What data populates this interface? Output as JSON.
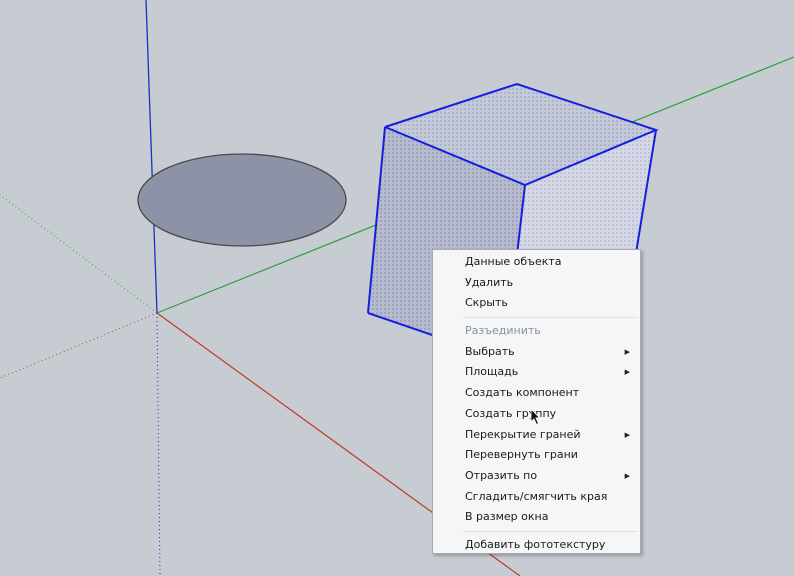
{
  "viewport": {
    "scene": "3d-modeling-viewport",
    "axis_colors": {
      "red": "#c0392b",
      "green": "#2e9e3a",
      "blue": "#1b2ecc"
    }
  },
  "context_menu": {
    "items": [
      {
        "label": "Данные объекта",
        "submenu": false,
        "disabled": false
      },
      {
        "label": "Удалить",
        "submenu": false,
        "disabled": false
      },
      {
        "label": "Скрыть",
        "submenu": false,
        "disabled": false
      },
      {
        "separator": true
      },
      {
        "label": "Разъединить",
        "submenu": false,
        "disabled": true
      },
      {
        "label": "Выбрать",
        "submenu": true,
        "disabled": false
      },
      {
        "label": "Площадь",
        "submenu": true,
        "disabled": false
      },
      {
        "label": "Создать компонент",
        "submenu": false,
        "disabled": false
      },
      {
        "label": "Создать группу",
        "submenu": false,
        "disabled": false
      },
      {
        "label": "Перекрытие граней",
        "submenu": true,
        "disabled": false
      },
      {
        "label": "Перевернуть грани",
        "submenu": false,
        "disabled": false
      },
      {
        "label": "Отразить по",
        "submenu": true,
        "disabled": false
      },
      {
        "label": "Сгладить/смягчить края",
        "submenu": false,
        "disabled": false
      },
      {
        "label": "В размер окна",
        "submenu": false,
        "disabled": false
      },
      {
        "separator": true
      },
      {
        "label": "Добавить фототекстуру",
        "submenu": false,
        "disabled": false
      }
    ]
  }
}
